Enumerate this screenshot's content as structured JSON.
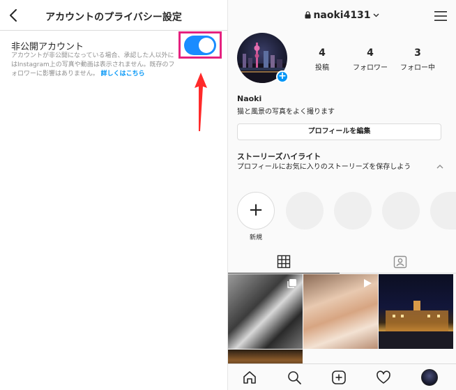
{
  "privacy_settings": {
    "title": "アカウントのプライバシー設定",
    "back_icon": "chevron-left-icon",
    "private_account": {
      "label": "非公開アカウント",
      "description": "アカウントが非公開になっている場合、承認した人以外にはInstagram上の写真や動画は表示されません。既存のフォロワーに影響はありません。",
      "learn_more": "詳しくはこちら",
      "enabled": true
    },
    "toggle_color": "#1a8cff",
    "highlight_color": "#e5217f",
    "arrow_color": "#ff2a2a"
  },
  "profile": {
    "username": "naoki4131",
    "lock_icon": "lock-icon",
    "menu_icon": "hamburger-menu-icon",
    "stats": [
      {
        "count": "4",
        "label": "投稿"
      },
      {
        "count": "4",
        "label": "フォロワー"
      },
      {
        "count": "3",
        "label": "フォロー中"
      }
    ],
    "name": "Naoki",
    "bio": "猫と風景の写真をよく撮ります",
    "edit_button": "プロフィールを編集",
    "highlights": {
      "title": "ストーリーズハイライト",
      "description": "プロフィールにお気に入りのストーリーズを保存しよう",
      "new_label": "新規"
    },
    "tabs": [
      {
        "name": "grid",
        "icon": "grid-icon",
        "active": true
      },
      {
        "name": "tagged",
        "icon": "tagged-person-icon",
        "active": false
      }
    ],
    "posts": [
      {
        "badge": "multiple-photos-icon"
      },
      {
        "badge": "video-play-icon"
      },
      {
        "badge": ""
      },
      {
        "badge": ""
      }
    ],
    "bottom_nav": [
      "home-icon",
      "search-icon",
      "new-post-icon",
      "heart-icon",
      "profile-avatar"
    ],
    "accent_color": "#0095f6"
  }
}
